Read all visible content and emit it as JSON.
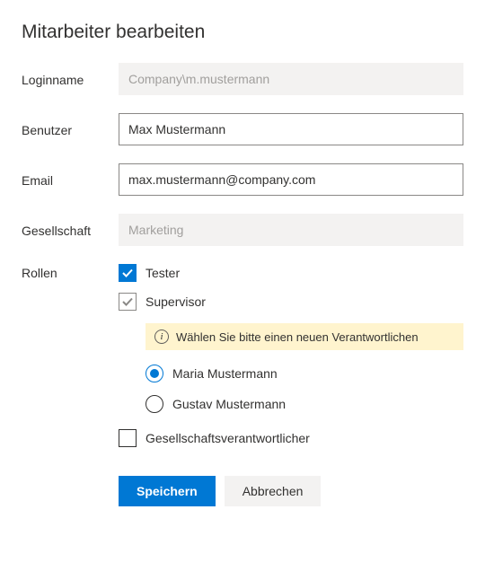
{
  "page_title": "Mitarbeiter bearbeiten",
  "fields": {
    "loginname": {
      "label": "Loginname",
      "value": "Company\\m.mustermann",
      "readonly": true
    },
    "user": {
      "label": "Benutzer",
      "value": "Max Mustermann",
      "readonly": false
    },
    "email": {
      "label": "Email",
      "value": "max.mustermann@company.com",
      "readonly": false
    },
    "company": {
      "label": "Gesellschaft",
      "value": "Marketing",
      "readonly": true
    }
  },
  "roles": {
    "label": "Rollen",
    "items": [
      {
        "key": "tester",
        "label": "Tester",
        "state": "checked"
      },
      {
        "key": "supervisor",
        "label": "Supervisor",
        "state": "mixed"
      },
      {
        "key": "company_responsible",
        "label": "Gesellschaftsverantwortlicher",
        "state": "unchecked"
      }
    ],
    "supervisor_panel": {
      "info_text": "Wählen Sie bitte einen neuen Verantwortlichen",
      "options": [
        {
          "key": "maria",
          "label": "Maria Mustermann",
          "selected": true
        },
        {
          "key": "gustav",
          "label": "Gustav Mustermann",
          "selected": false
        }
      ]
    }
  },
  "buttons": {
    "save": "Speichern",
    "cancel": "Abbrechen"
  }
}
